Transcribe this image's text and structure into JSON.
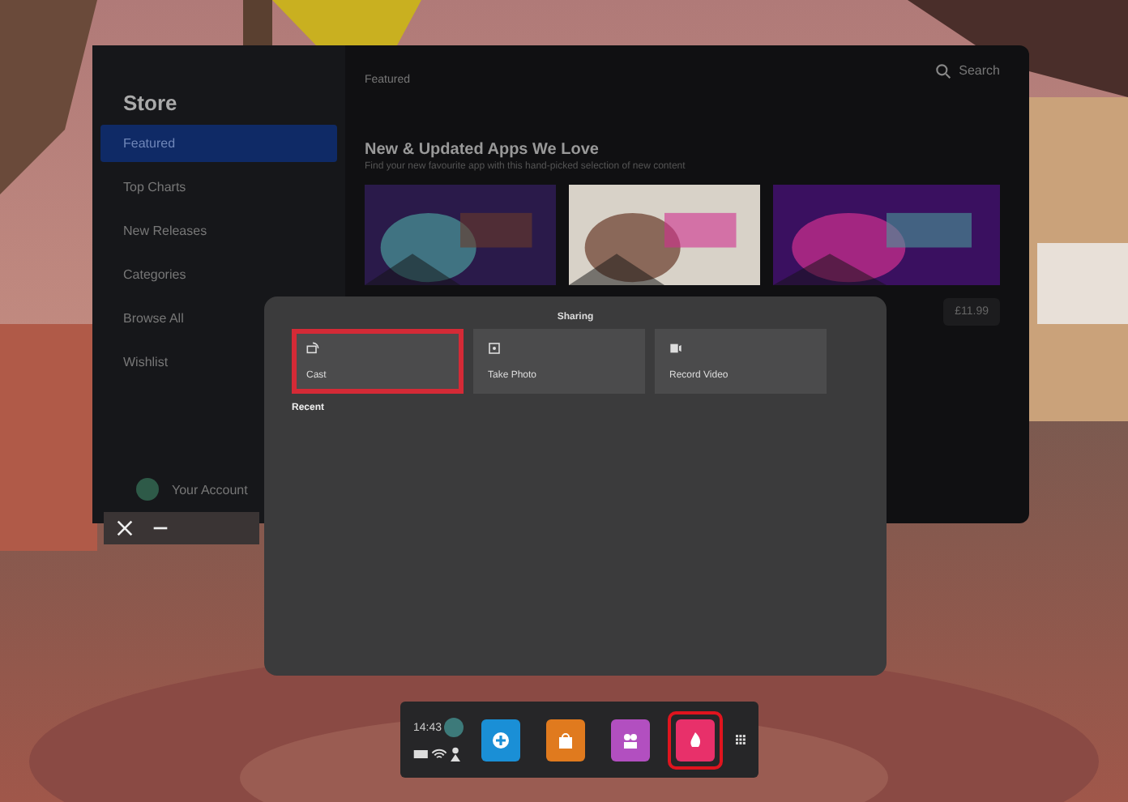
{
  "store": {
    "title": "Store",
    "sidebar": [
      {
        "label": "Featured",
        "selected": true
      },
      {
        "label": "Top Charts",
        "selected": false
      },
      {
        "label": "New Releases",
        "selected": false
      },
      {
        "label": "Categories",
        "selected": false
      },
      {
        "label": "Browse All",
        "selected": false
      },
      {
        "label": "Wishlist",
        "selected": false
      }
    ],
    "account": "Your Account",
    "tab": "Featured",
    "search": "Search",
    "heading": "New & Updated Apps We Love",
    "subheading": "Find your new favourite app with this hand-picked selection of new content",
    "price": "£11.99"
  },
  "sharing": {
    "title": "Sharing",
    "tiles": [
      {
        "kind": "cast",
        "label": "Cast",
        "highlighted": true
      },
      {
        "label": "Take Photo",
        "highlighted": false
      },
      {
        "kind": "video",
        "label": "Record Video",
        "highlighted": false
      }
    ],
    "recent": "Recent"
  },
  "dock": {
    "time": "14:43",
    "apps": [
      {
        "kind": "explore",
        "color": "#1a8fd6",
        "highlighted": false
      },
      {
        "kind": "store",
        "color": "#e07a1e",
        "highlighted": false
      },
      {
        "kind": "people",
        "color": "#b24fc0",
        "highlighted": false
      },
      {
        "kind": "sharing",
        "color": "#e8306a",
        "highlighted": true
      }
    ]
  }
}
